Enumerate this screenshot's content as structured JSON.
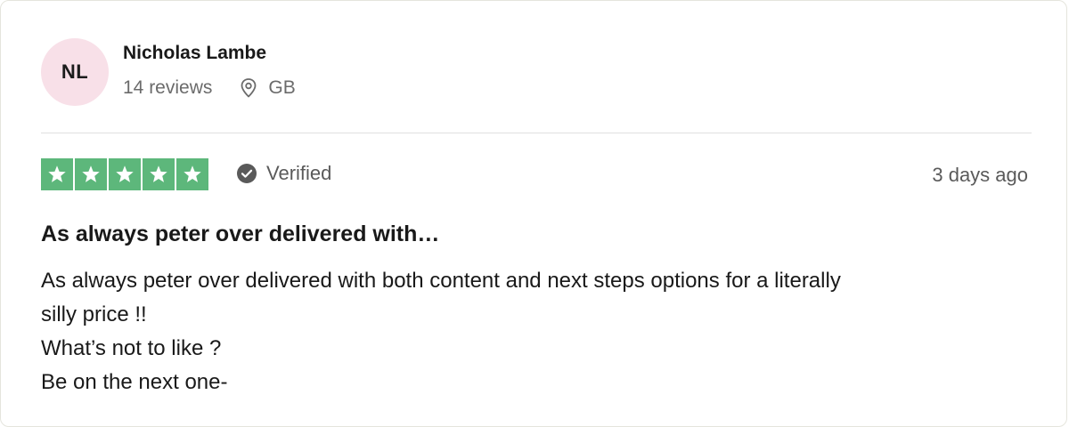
{
  "reviewer": {
    "initials": "NL",
    "name": "Nicholas Lambe",
    "reviews_count": "14 reviews",
    "location": "GB",
    "avatar_color": "#f8e0e8"
  },
  "rating": {
    "stars": 5,
    "max_stars": 5,
    "star_color": "#5db77b",
    "verified_label": "Verified",
    "date": "3 days ago"
  },
  "review": {
    "title": "As always peter over delivered with…",
    "lines": [
      "As always peter over delivered with both content and next steps options for a literally",
      "silly price !!",
      "What’s not to like ?",
      "Be on the next one-"
    ]
  },
  "icons": {
    "location": "location-pin-icon",
    "verified": "check-circle-icon",
    "star": "star-icon"
  }
}
